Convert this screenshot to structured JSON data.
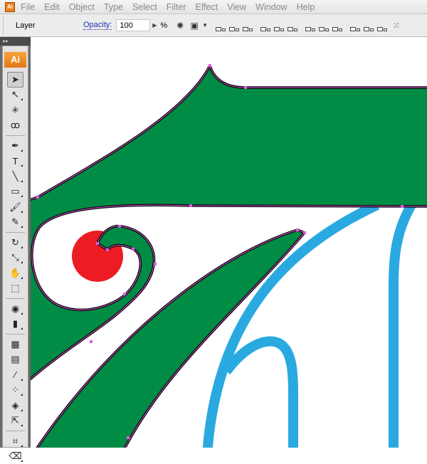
{
  "app": {
    "logo": "Ai"
  },
  "menu": [
    "File",
    "Edit",
    "Object",
    "Type",
    "Select",
    "Filter",
    "Effect",
    "View",
    "Window",
    "Help"
  ],
  "control": {
    "selection_label": "Layer",
    "opacity_label": "Opacity:",
    "opacity_value": "100",
    "percent": "%"
  },
  "tools": [
    "selection-tool",
    "direct-selection-tool",
    "magic-wand-tool",
    "lasso-tool",
    "pen-tool",
    "type-tool",
    "line-segment-tool",
    "rectangle-tool",
    "paintbrush-tool",
    "pencil-tool",
    "rotate-tool",
    "scale-tool",
    "warp-tool",
    "free-transform-tool",
    "symbol-sprayer-tool",
    "column-graph-tool",
    "mesh-tool",
    "gradient-tool",
    "eyedropper-tool",
    "blend-tool",
    "live-paint-bucket-tool",
    "live-paint-selection-tool",
    "crop-area-tool",
    "eraser-tool"
  ],
  "colors": {
    "green": "#008c44",
    "red": "#ec1c24",
    "blue": "#29a9e0",
    "path": "#e05ce0"
  }
}
